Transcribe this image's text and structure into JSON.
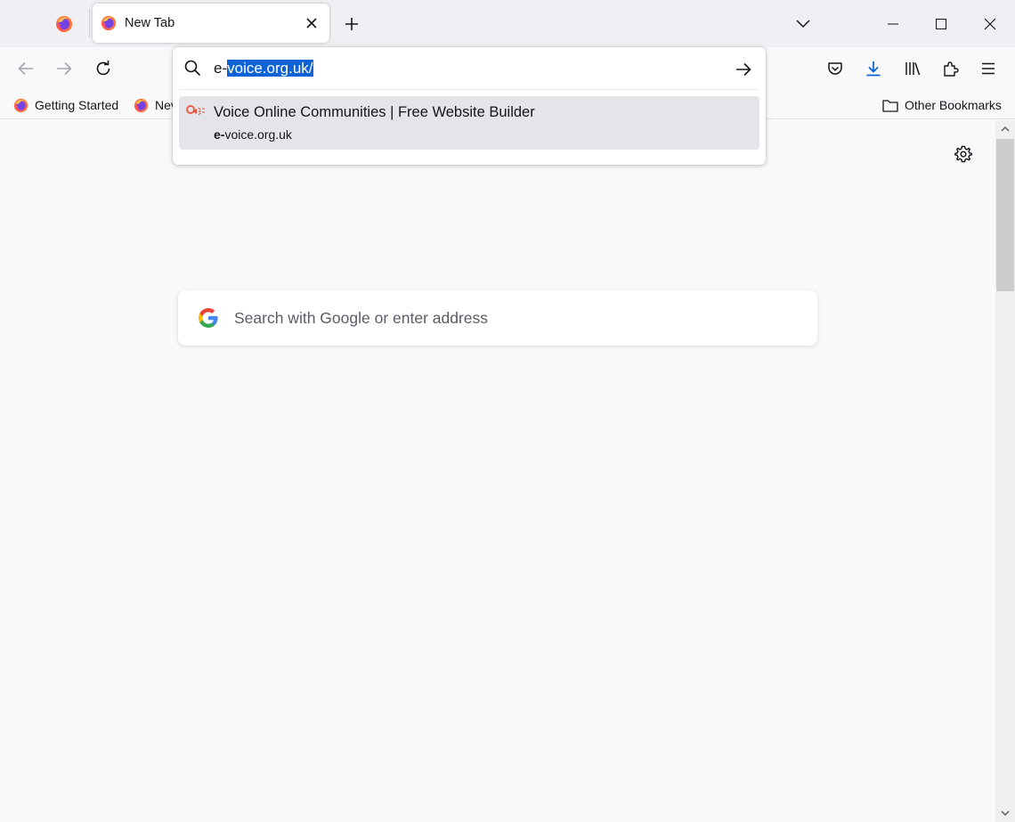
{
  "tabs": {
    "active_title": "New Tab"
  },
  "bookmarks": {
    "items": [
      {
        "label": "Getting Started"
      },
      {
        "label": "Nev"
      }
    ],
    "other_label": "Other Bookmarks"
  },
  "urlbar": {
    "prefix": "e-",
    "selected": "voice.org.uk/"
  },
  "suggestion": {
    "title": "Voice Online Communities | Free Website Builder",
    "url_bold": "e-",
    "url_rest": "voice.org.uk"
  },
  "newtab": {
    "search_placeholder": "Search with Google or enter address"
  },
  "colors": {
    "accent": "#0b63d6",
    "downloads_icon": "#0060df",
    "suggestion_icon": "#e8553a"
  },
  "icons": [
    "firefox-icon",
    "close-icon",
    "plus-icon",
    "chevron-down-icon",
    "minimize-icon",
    "maximize-icon",
    "back-arrow-icon",
    "forward-arrow-icon",
    "reload-icon",
    "pocket-icon",
    "download-icon",
    "library-icon",
    "extensions-icon",
    "hamburger-menu-icon",
    "folder-icon",
    "search-icon",
    "arrow-right-icon",
    "gear-icon",
    "google-logo-icon"
  ]
}
